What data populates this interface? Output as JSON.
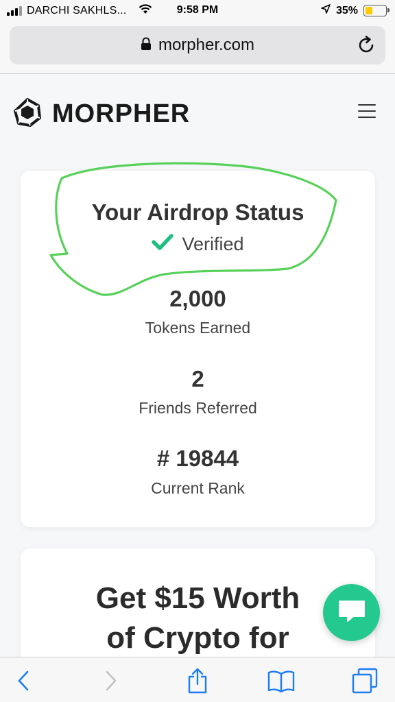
{
  "status_bar": {
    "carrier": "DARCHI SAKHLS...",
    "time": "9:58 PM",
    "battery": "35%",
    "battery_level": 0.35,
    "icons": [
      "signal-icon",
      "wifi-icon",
      "location-icon",
      "battery-icon"
    ]
  },
  "browser": {
    "url": "morpher.com",
    "icons": [
      "lock-icon",
      "reload-icon"
    ]
  },
  "site": {
    "brand": "MORPHER",
    "icons": [
      "morpher-logo-icon",
      "hamburger-menu-icon"
    ]
  },
  "status_card": {
    "title": "Your Airdrop Status",
    "status": "Verified",
    "stats": [
      {
        "value": "2,000",
        "label": "Tokens Earned"
      },
      {
        "value": "2",
        "label": "Friends Referred"
      },
      {
        "value": "# 19844",
        "label": "Current Rank"
      }
    ]
  },
  "promo": {
    "title_line1": "Get $15 Worth",
    "title_line2": "of Crypto for"
  },
  "toolbar": {
    "icons": [
      "back-icon",
      "forward-icon",
      "share-icon",
      "bookmarks-icon",
      "tabs-icon"
    ]
  },
  "colors": {
    "accent_green": "#23c98e",
    "annotation_green": "#57d15a",
    "check_green": "#1fbf7f"
  }
}
